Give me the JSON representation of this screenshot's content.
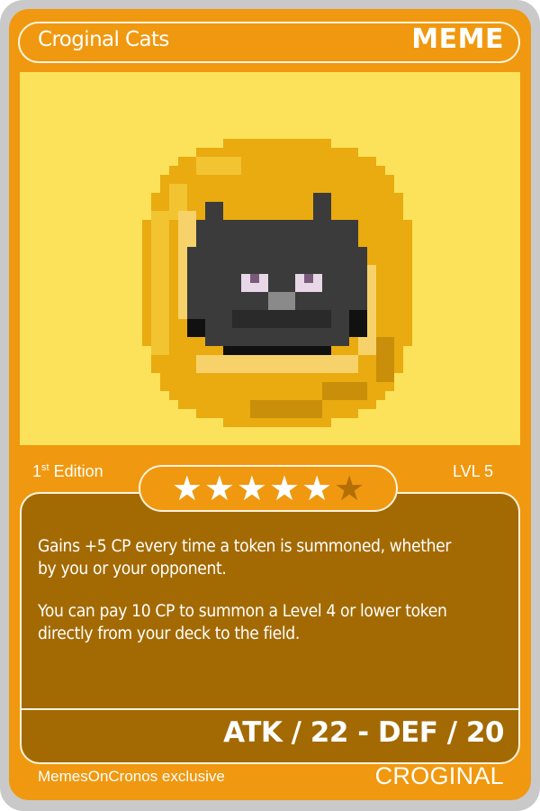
{
  "card": {
    "name": "Croginal Cats",
    "type": "MEME",
    "edition_number": "1",
    "edition_suffix": "st",
    "edition_label": " Edition",
    "level": "LVL 5",
    "rating": {
      "filled": 5,
      "total": 6
    },
    "ability_1": "Gains +5 CP every time a token is summoned, whether by you or your opponent.",
    "ability_2": "You can pay 10 CP to summon a Level 4 or lower token directly from your deck to the field.",
    "stats": "ATK / 22 - DEF / 20",
    "footer_left": "MemesOnCronos exclusive",
    "footer_right": "CROGINAL"
  },
  "colors": {
    "card_frame": "#f0980f",
    "text_box": "#a36a03",
    "art_background": "#fbe25a",
    "coin": "#e9ab10",
    "cat": "#3b3b3b"
  },
  "icons": {
    "star_filled": "star-filled-icon",
    "star_empty": "star-empty-icon",
    "artwork": "pixel-cat-coin"
  }
}
